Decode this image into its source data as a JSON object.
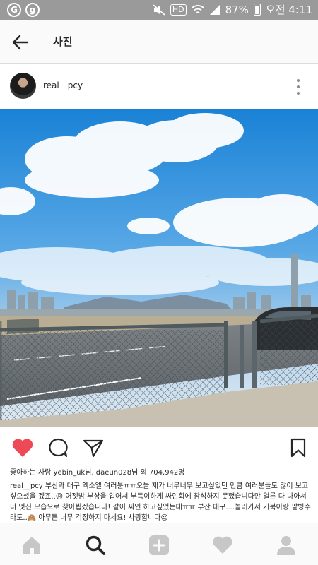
{
  "status_bar": {
    "icon_left_1": "G",
    "icon_left_2": "g",
    "hd": "HD",
    "battery": "87%",
    "time": "오전 4:11"
  },
  "header": {
    "title": "사진"
  },
  "post": {
    "username": "real__pcy",
    "likes_text": "좋아하는 사람 yebin_uk님, daeun028님 외 704,942명",
    "caption_user": "real__pcy",
    "caption_text": "부산과 대구 엑소엘 여러분ㅠㅠ오늘 제가 너무너무 보고싶었던 만큼 여러분들도 많이 보고싶으셨을 겠죠..😥 어젯밤 부상을 입어서 부득이하게 싸인회에 참석하지 못했습니다만 얼른 다 나아서 더 멋진 모습으로 찾아뵙겠습니다! 같이 싸인 하고싶었는데ㅠㅠ 부산 대구....놀러가서 거북이랑 팥빙수라도..🙈 아무튼 너무 걱정하지 마세요! 사랑합니다😍"
  },
  "icons": {
    "back": "back-arrow-icon",
    "more": "more-vertical-icon",
    "like": "heart-icon",
    "comment": "comment-icon",
    "share": "direct-share-icon",
    "save": "bookmark-icon",
    "home": "home-icon",
    "search": "search-icon",
    "add": "add-post-icon",
    "activity": "activity-heart-icon",
    "profile": "profile-icon"
  },
  "colors": {
    "like_active": "#ed4956",
    "status_bar": "#9a9a9a",
    "nav_inactive": "#c7c7c7"
  }
}
